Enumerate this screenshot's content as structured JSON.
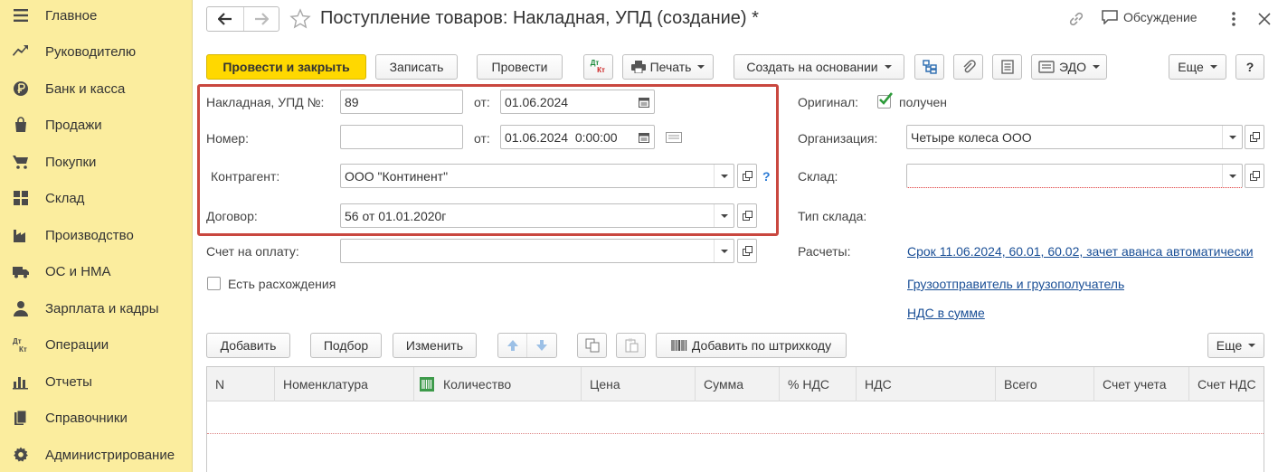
{
  "sidebar": {
    "items": [
      {
        "label": "Главное",
        "icon": "menu-icon"
      },
      {
        "label": "Руководителю",
        "icon": "trend-icon"
      },
      {
        "label": "Банк и касса",
        "icon": "ruble-coin-icon"
      },
      {
        "label": "Продажи",
        "icon": "shopping-bag-icon"
      },
      {
        "label": "Покупки",
        "icon": "cart-icon"
      },
      {
        "label": "Склад",
        "icon": "warehouse-grid-icon"
      },
      {
        "label": "Производство",
        "icon": "factory-icon"
      },
      {
        "label": "ОС и НМА",
        "icon": "truck-icon"
      },
      {
        "label": "Зарплата и кадры",
        "icon": "person-icon"
      },
      {
        "label": "Операции",
        "icon": "dt-kt-icon"
      },
      {
        "label": "Отчеты",
        "icon": "bar-chart-icon"
      },
      {
        "label": "Справочники",
        "icon": "books-icon"
      },
      {
        "label": "Администрирование",
        "icon": "gear-icon"
      }
    ]
  },
  "header": {
    "title": "Поступление товаров: Накладная, УПД (создание) *",
    "discussion": "Обсуждение"
  },
  "toolbar": {
    "post_close": "Провести и закрыть",
    "save": "Записать",
    "post": "Провести",
    "dtkt_top": "Дт",
    "dtkt_bottom": "Кт",
    "print": "Печать",
    "create_based": "Создать на основании",
    "edo": "ЭДО",
    "more": "Еще",
    "help": "?"
  },
  "form": {
    "invoice_label": "Накладная, УПД №:",
    "invoice_number": "89",
    "from_label": "от:",
    "invoice_date": "01.06.2024",
    "number_label": "Номер:",
    "number_value": "",
    "from_label2": "от:",
    "number_datetime": "01.06.2024  0:00:00",
    "counterparty_label": "Контрагент:",
    "counterparty_value": "ООО \"Континент\"",
    "help_mark": "?",
    "contract_label": "Договор:",
    "contract_value": "56 от 01.01.2020г",
    "payment_invoice_label": "Счет на оплату:",
    "payment_invoice_value": "",
    "discrepancies_label": "Есть расхождения",
    "discrepancies_checked": false,
    "original_label": "Оригинал:",
    "original_checked": true,
    "original_value": "получен",
    "organization_label": "Организация:",
    "organization_value": "Четыре колеса ООО",
    "warehouse_label": "Склад:",
    "warehouse_value": "",
    "warehouse_type_label": "Тип склада:",
    "settlements_label": "Расчеты:",
    "settlements_link": "Срок 11.06.2024, 60.01, 60.02, зачет аванса автоматически",
    "shipper_link": "Грузоотправитель и грузополучатель",
    "vat_link": "НДС в сумме"
  },
  "table_toolbar": {
    "add": "Добавить",
    "select": "Подбор",
    "change": "Изменить",
    "add_barcode": "Добавить по штрихкоду",
    "more": "Еще"
  },
  "table": {
    "columns": [
      "N",
      "Номенклатура",
      "Количество",
      "Цена",
      "Сумма",
      "% НДС",
      "НДС",
      "Всего",
      "Счет учета",
      "Счет НДС"
    ],
    "rows": []
  },
  "colors": {
    "sidebar_bg": "#fbed9e",
    "primary_button": "#ffd800",
    "highlight_border": "#c9473f",
    "link": "#1a4f96",
    "checkbox_green": "#2d9b3a"
  }
}
